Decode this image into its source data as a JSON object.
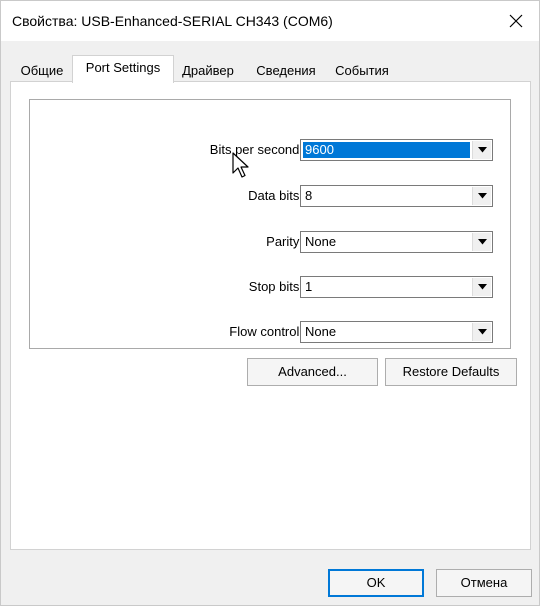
{
  "window": {
    "title": "Свойства: USB-Enhanced-SERIAL CH343 (COM6)"
  },
  "tabs": [
    {
      "label": "Общие"
    },
    {
      "label": "Port Settings"
    },
    {
      "label": "Драйвер"
    },
    {
      "label": "Сведения"
    },
    {
      "label": "События"
    }
  ],
  "settings": {
    "bits_per_second": {
      "label": "Bits per second:",
      "value": "9600"
    },
    "data_bits": {
      "label": "Data bits:",
      "value": "8"
    },
    "parity": {
      "label": "Parity:",
      "value": "None"
    },
    "stop_bits": {
      "label": "Stop bits:",
      "value": "1"
    },
    "flow_control": {
      "label": "Flow control:",
      "value": "None"
    }
  },
  "buttons": {
    "advanced": "Advanced...",
    "restore_defaults": "Restore Defaults",
    "ok": "OK",
    "cancel": "Отмена"
  },
  "icons": {
    "close": "close-icon",
    "dropdown": "chevron-down-icon",
    "cursor": "mouse-pointer-icon"
  },
  "colors": {
    "selection": "#0078d7",
    "dialog_background": "#f0f0f0",
    "panel_background": "#ffffff"
  }
}
